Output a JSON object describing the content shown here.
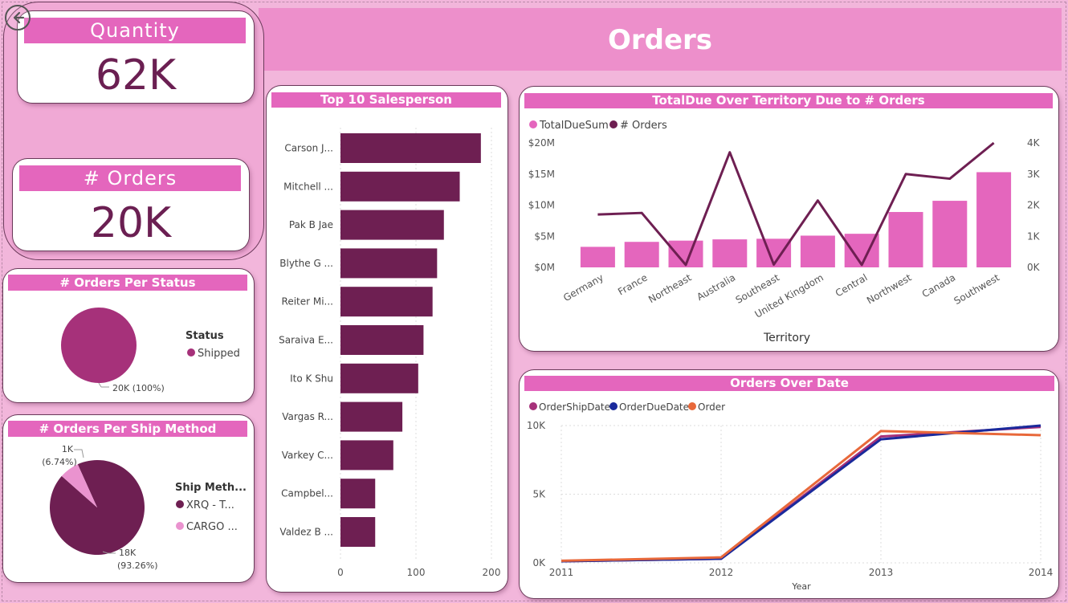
{
  "page": {
    "title": "Orders",
    "back_icon": "back-arrow-icon"
  },
  "kpis": {
    "quantity": {
      "label": "Quantity",
      "value": "62K"
    },
    "orders": {
      "label": "# Orders",
      "value": "20K"
    }
  },
  "colors": {
    "accent": "#e466bd",
    "dark": "#6e1f52",
    "mid": "#a6317a",
    "light_pink": "#ea93cf",
    "navy": "#1a2a9c",
    "orange": "#e8683a"
  },
  "chart_data": [
    {
      "id": "status_pie",
      "type": "pie",
      "title": "# Orders Per Status",
      "legend_title": "Status",
      "legend_position": "right",
      "slices": [
        {
          "name": "Shipped",
          "value": 20000,
          "label": "20K (100%)",
          "color": "#a6317a"
        }
      ]
    },
    {
      "id": "ship_method_pie",
      "type": "pie",
      "title": "# Orders Per Ship Method",
      "legend_title": "Ship Meth...",
      "legend_position": "right",
      "slices": [
        {
          "name": "XRQ - T...",
          "value": 93.26,
          "label_top": "18K",
          "label_bottom": "(93.26%)",
          "color": "#6e1f52"
        },
        {
          "name": "CARGO ...",
          "value": 6.74,
          "label_top": "1K",
          "label_bottom": "(6.74%)",
          "color": "#ea93cf"
        }
      ]
    },
    {
      "id": "salesperson_bar",
      "type": "bar",
      "orientation": "horizontal",
      "title": "Top 10 Salesperson",
      "categories": [
        "Carson J...",
        "Mitchell ...",
        "Pak B Jae",
        "Blythe G ...",
        "Reiter Mi...",
        "Saraiva E...",
        "Ito K Shu",
        "Vargas R...",
        "Varkey C...",
        "Campbel...",
        "Valdez B ..."
      ],
      "values": [
        186,
        158,
        137,
        128,
        122,
        110,
        103,
        82,
        70,
        46,
        46
      ],
      "xticks": [
        "0",
        "100",
        "200"
      ],
      "xlim": [
        0,
        200
      ],
      "grid": true
    },
    {
      "id": "territory_combo",
      "type": "bar",
      "title": "TotalDue Over Territory Due to # Orders",
      "xlabel": "Territory",
      "categories": [
        "Germany",
        "France",
        "Northeast",
        "Australia",
        "Southeast",
        "United Kingdom",
        "Central",
        "Northwest",
        "Canada",
        "Southwest"
      ],
      "series": [
        {
          "name": "TotalDueSum",
          "kind": "bar",
          "axis": "left",
          "values": [
            3.3,
            4.1,
            4.3,
            4.5,
            4.6,
            5.1,
            5.4,
            8.9,
            10.7,
            15.3
          ]
        },
        {
          "name": "# Orders",
          "kind": "line",
          "axis": "right",
          "values": [
            1700,
            1750,
            80,
            3700,
            90,
            2150,
            80,
            3000,
            2850,
            4000
          ]
        }
      ],
      "y_left_ticks": [
        "$0M",
        "$5M",
        "$10M",
        "$15M",
        "$20M"
      ],
      "y_left_lim": [
        0,
        20
      ],
      "y_right_ticks": [
        "0K",
        "1K",
        "2K",
        "3K",
        "4K"
      ],
      "y_right_lim": [
        0,
        4000
      ],
      "legend_position": "top-left"
    },
    {
      "id": "orders_over_date",
      "type": "line",
      "title": "Orders Over Date",
      "xlabel": "Year",
      "x": [
        "2011",
        "2012",
        "2013",
        "2014"
      ],
      "series": [
        {
          "name": "OrderShipDate",
          "values": [
            120,
            300,
            9200,
            9900
          ],
          "color": "#a6317a"
        },
        {
          "name": "OrderDueDate",
          "values": [
            120,
            300,
            9000,
            10000
          ],
          "color": "#1a2a9c"
        },
        {
          "name": "Order",
          "values": [
            150,
            400,
            9600,
            9300
          ],
          "color": "#e8683a"
        }
      ],
      "yticks": [
        "0K",
        "5K",
        "10K"
      ],
      "ylim": [
        0,
        10000
      ],
      "legend_position": "top-left",
      "grid": true
    }
  ]
}
